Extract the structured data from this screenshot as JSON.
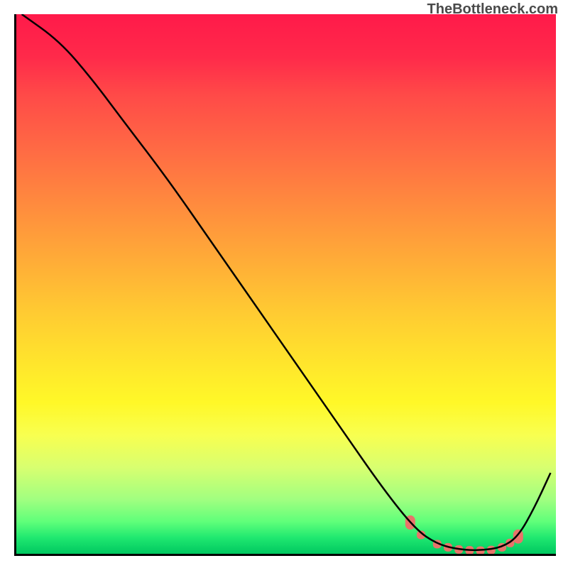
{
  "watermark": "TheBottleneck.com",
  "chart_data": {
    "type": "line",
    "title": "",
    "xlabel": "",
    "ylabel": "",
    "xlim": [
      0,
      100
    ],
    "ylim": [
      0,
      100
    ],
    "grid": false,
    "series": [
      {
        "name": "curve",
        "color": "#000000",
        "x": [
          1,
          8,
          14,
          20,
          28,
          36,
          44,
          52,
          60,
          68,
          74,
          78,
          82,
          86,
          90,
          93,
          96,
          99
        ],
        "y": [
          100,
          95,
          88,
          80,
          69.5,
          58,
          46.5,
          35,
          23.5,
          12,
          4.5,
          1.8,
          0.8,
          0.6,
          1.2,
          3.2,
          8.5,
          15
        ]
      }
    ],
    "highlight_region": {
      "x_start": 72,
      "x_end": 93,
      "color": "#e8746a",
      "points_x": [
        73,
        75,
        78,
        80,
        82,
        84,
        86,
        88,
        90,
        91.5,
        93
      ],
      "points_y": [
        5.8,
        3.5,
        1.8,
        1.2,
        0.8,
        0.65,
        0.6,
        0.7,
        1.2,
        2.0,
        3.2
      ]
    },
    "background": {
      "type": "gradient-vertical",
      "stops": [
        {
          "pos": 0,
          "color": "#ff1a4a"
        },
        {
          "pos": 50,
          "color": "#ffca32"
        },
        {
          "pos": 75,
          "color": "#fff828"
        },
        {
          "pos": 100,
          "color": "#00c860"
        }
      ]
    }
  }
}
